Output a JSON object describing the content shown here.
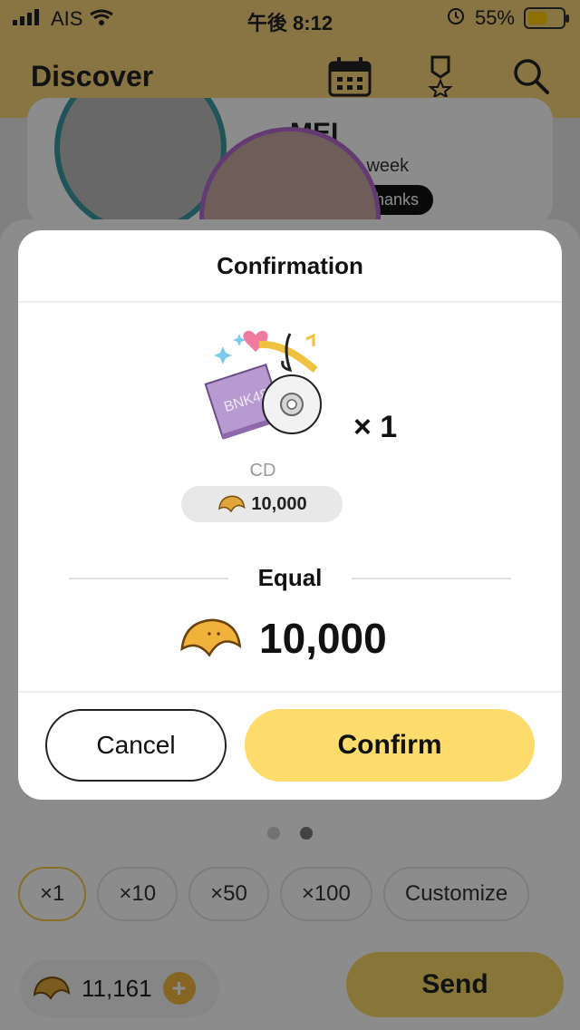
{
  "status_bar": {
    "carrier": "AIS",
    "time": "午後 8:12",
    "battery_percent": "55%",
    "battery_level": 0.55
  },
  "header": {
    "title": "Discover",
    "icons": [
      "calendar-icon",
      "medal-icon",
      "search-icon"
    ]
  },
  "feature": {
    "name": "MEI",
    "subtitle": "f the week",
    "thanks": "ial thanks"
  },
  "modal": {
    "title": "Confirmation",
    "gift_name": "CD",
    "gift_multiplier": "× 1",
    "gift_price": "10,000",
    "equal_label": "Equal",
    "total_amount": "10,000",
    "cancel_label": "Cancel",
    "confirm_label": "Confirm",
    "gift_art_text": "BNK48"
  },
  "pager": {
    "total": 2,
    "active": 2
  },
  "quantity_options": [
    "×1",
    "×10",
    "×50",
    "×100",
    "Customize"
  ],
  "selected_quantity_index": 0,
  "wallet": {
    "balance": "11,161",
    "send_label": "Send"
  },
  "colors": {
    "accent": "#fddc6b",
    "header_bg": "#f7d57a",
    "text": "#111111"
  }
}
